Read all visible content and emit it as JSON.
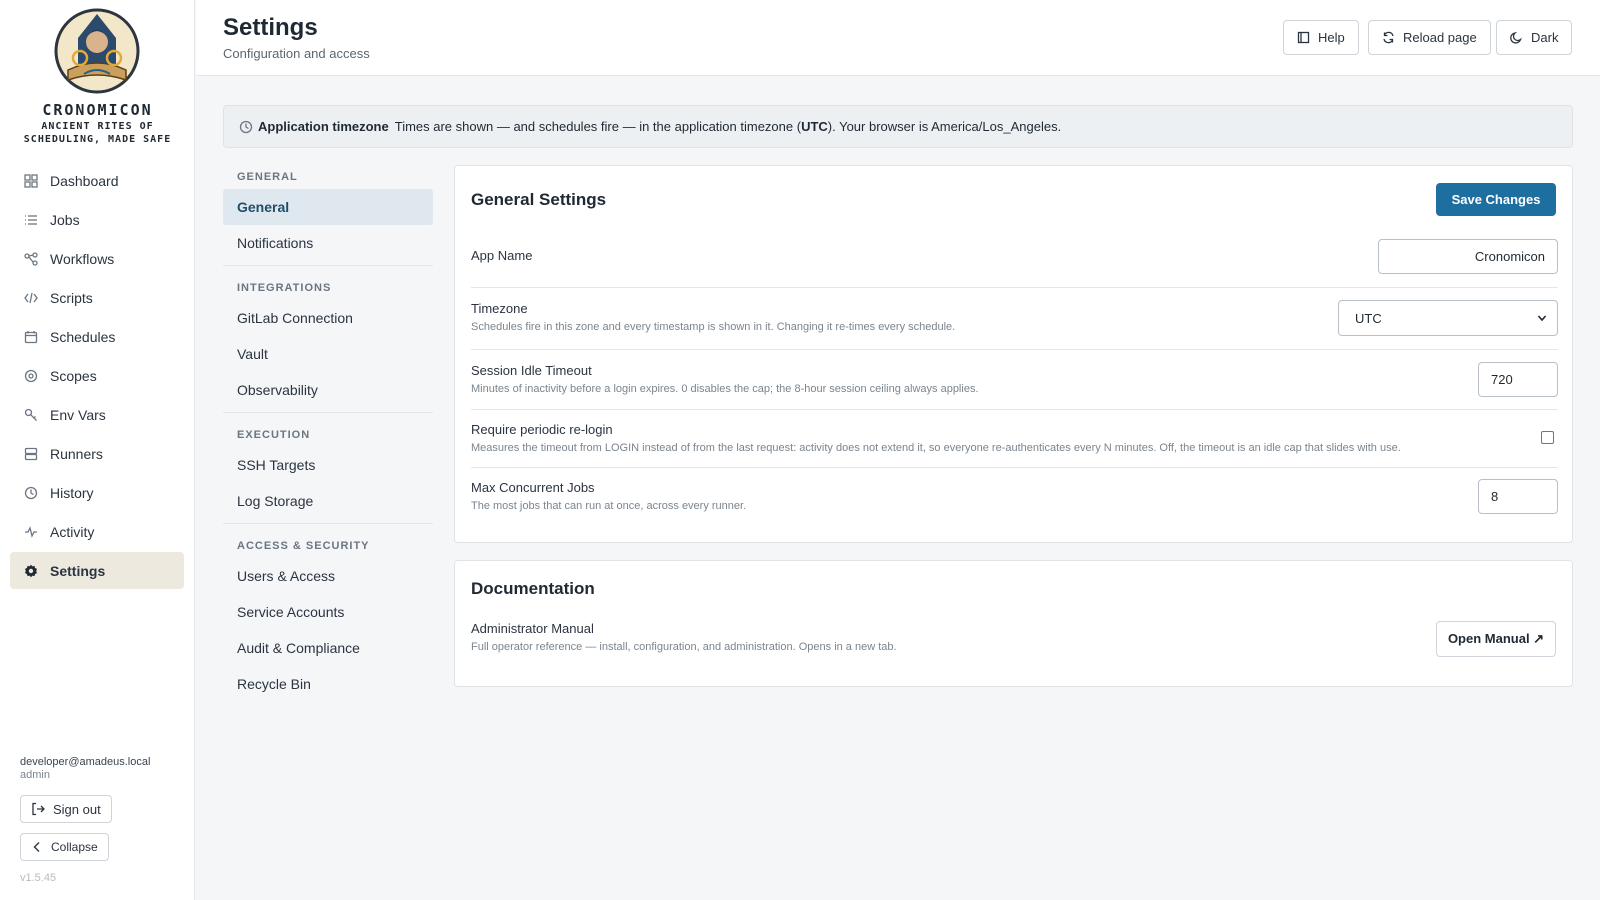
{
  "sidebar": {
    "brand": {
      "title": "CRONOMICON",
      "tagline_1": "ANCIENT RITES OF",
      "tagline_2": "SCHEDULING, MADE SAFE"
    },
    "items": [
      {
        "label": "Dashboard",
        "icon": "grid-icon"
      },
      {
        "label": "Jobs",
        "icon": "list-icon"
      },
      {
        "label": "Workflows",
        "icon": "workflow-icon"
      },
      {
        "label": "Scripts",
        "icon": "code-icon"
      },
      {
        "label": "Schedules",
        "icon": "calendar-icon"
      },
      {
        "label": "Scopes",
        "icon": "target-icon"
      },
      {
        "label": "Env Vars",
        "icon": "key-icon"
      },
      {
        "label": "Runners",
        "icon": "server-icon"
      },
      {
        "label": "History",
        "icon": "clock-icon"
      },
      {
        "label": "Activity",
        "icon": "pulse-icon"
      },
      {
        "label": "Settings",
        "icon": "gear-icon",
        "active": true
      }
    ],
    "user_email": "developer@amadeus.local",
    "user_role": "admin",
    "sign_out": "Sign out",
    "collapse": "Collapse",
    "version": "v1.5.45"
  },
  "header": {
    "title": "Settings",
    "subtitle": "Configuration and access",
    "help": "Help",
    "reload": "Reload page",
    "theme": "Dark"
  },
  "banner": {
    "label": "Application timezone",
    "text_1": "Times are shown — and schedules fire — in the application timezone (",
    "tz": "UTC",
    "text_2": "). Your browser is America/Los_Angeles."
  },
  "subnav": {
    "general_head": "GENERAL",
    "general": "General",
    "notifications": "Notifications",
    "integrations_head": "INTEGRATIONS",
    "gitlab": "GitLab Connection",
    "vault": "Vault",
    "observability": "Observability",
    "execution_head": "EXECUTION",
    "ssh": "SSH Targets",
    "log_storage": "Log Storage",
    "access_head": "ACCESS & SECURITY",
    "users": "Users & Access",
    "service_accounts": "Service Accounts",
    "audit": "Audit & Compliance",
    "recycle": "Recycle Bin"
  },
  "general": {
    "title": "General Settings",
    "save": "Save Changes",
    "app_name_label": "App Name",
    "app_name_value": "Cronomicon",
    "timezone_label": "Timezone",
    "timezone_help": "Schedules fire in this zone and every timestamp is shown in it. Changing it re-times every schedule.",
    "timezone_value": "UTC",
    "idle_label": "Session Idle Timeout",
    "idle_help": "Minutes of inactivity before a login expires. 0 disables the cap; the 8-hour session ceiling always applies.",
    "idle_value": "720",
    "relogin_label": "Require periodic re-login",
    "relogin_help": "Measures the timeout from LOGIN instead of from the last request: activity does not extend it, so everyone re-authenticates every N minutes. Off, the timeout is an idle cap that slides with use.",
    "relogin_checked": false,
    "maxjobs_label": "Max Concurrent Jobs",
    "maxjobs_help": "The most jobs that can run at once, across every runner.",
    "maxjobs_value": "8"
  },
  "docs": {
    "title": "Documentation",
    "manual_label": "Administrator Manual",
    "manual_help": "Full operator reference — install, configuration, and administration. Opens in a new tab.",
    "open_manual": "Open Manual ↗"
  }
}
